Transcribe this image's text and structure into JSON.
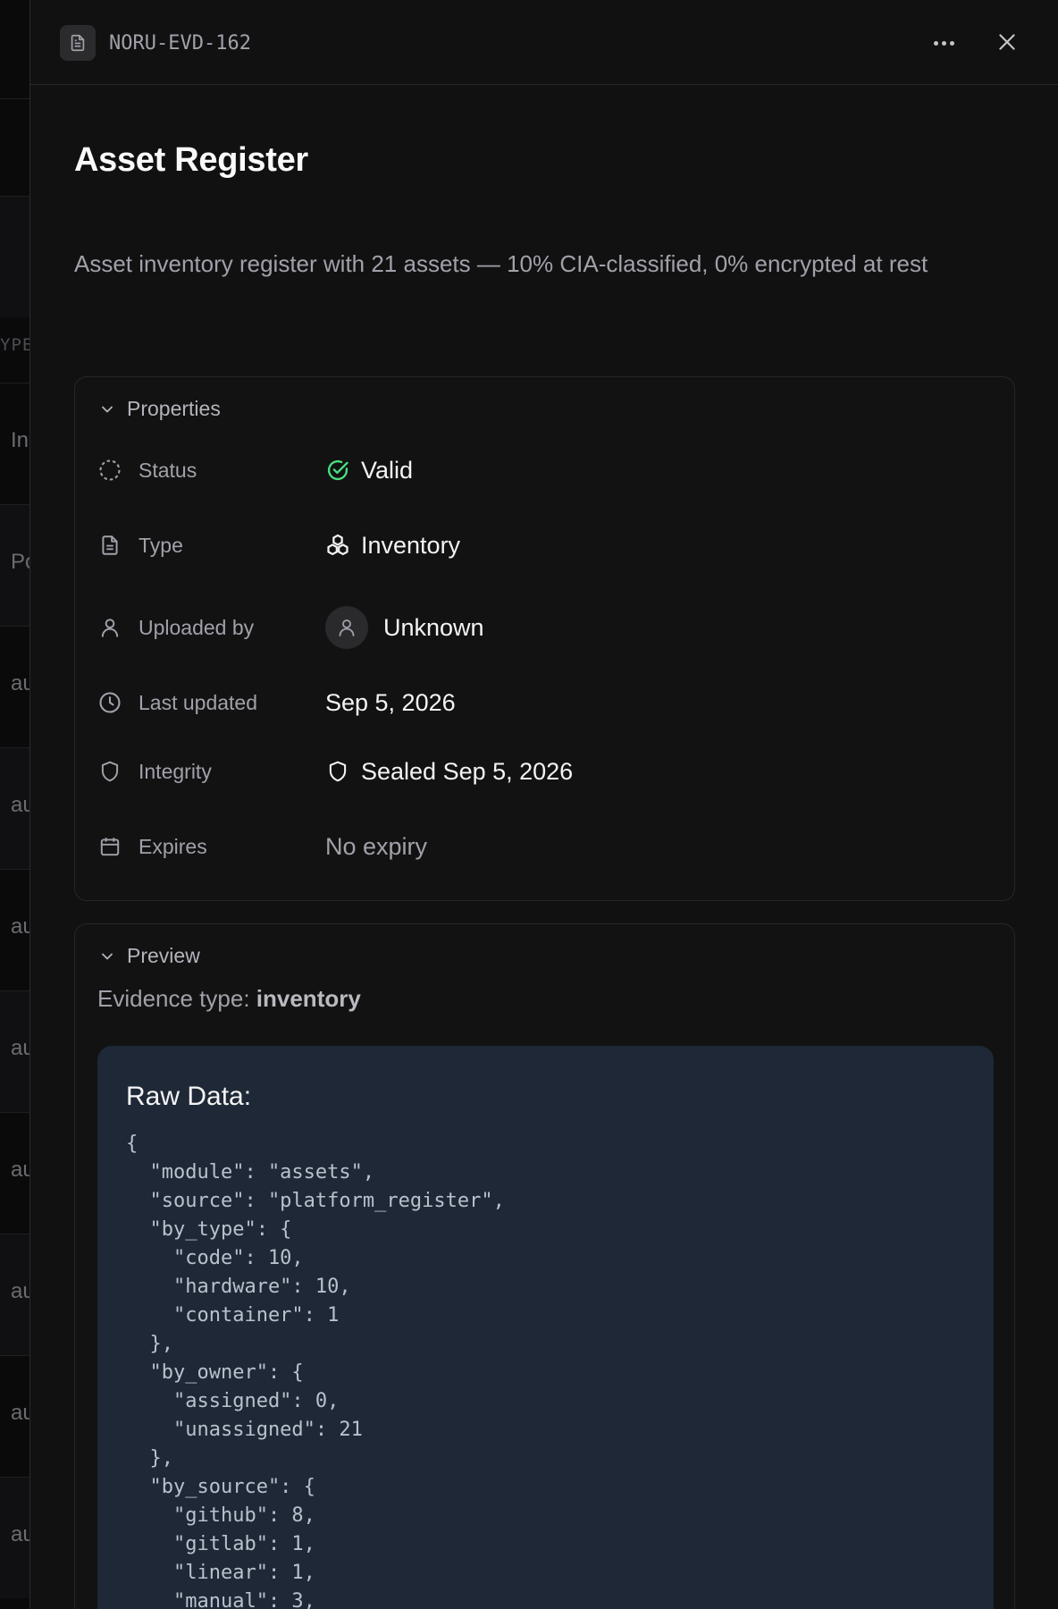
{
  "background": {
    "column_header": "YPE",
    "row_texts": [
      "In",
      "Po",
      "au",
      "au",
      "au",
      "au",
      "au",
      "au",
      "au",
      "au"
    ]
  },
  "header": {
    "evidence_id": "NORU-EVD-162",
    "icons": {
      "doc": "document-icon",
      "more": "more-horizontal-icon",
      "close": "close-icon"
    }
  },
  "evidence": {
    "title": "Asset Register",
    "description": "Asset inventory register with 21 assets — 10% CIA-classified, 0% encrypted at rest"
  },
  "properties": {
    "section_label": "Properties",
    "status": {
      "label": "Status",
      "value": "Valid",
      "color": "#4ade80"
    },
    "type": {
      "label": "Type",
      "value": "Inventory"
    },
    "uploaded_by": {
      "label": "Uploaded by",
      "value": "Unknown"
    },
    "last_updated": {
      "label": "Last updated",
      "value": "Sep 5, 2026"
    },
    "integrity": {
      "label": "Integrity",
      "value": "Sealed Sep 5, 2026"
    },
    "expires": {
      "label": "Expires",
      "value": "No expiry"
    }
  },
  "preview": {
    "section_label": "Preview",
    "evidence_type_label": "Evidence type:",
    "evidence_type_value": "inventory",
    "raw_title": "Raw Data:",
    "raw_json": "{\n  \"module\": \"assets\",\n  \"source\": \"platform_register\",\n  \"by_type\": {\n    \"code\": 10,\n    \"hardware\": 10,\n    \"container\": 1\n  },\n  \"by_owner\": {\n    \"assigned\": 0,\n    \"unassigned\": 21\n  },\n  \"by_source\": {\n    \"github\": 8,\n    \"gitlab\": 1,\n    \"linear\": 1,\n    \"manual\": 3,"
  }
}
